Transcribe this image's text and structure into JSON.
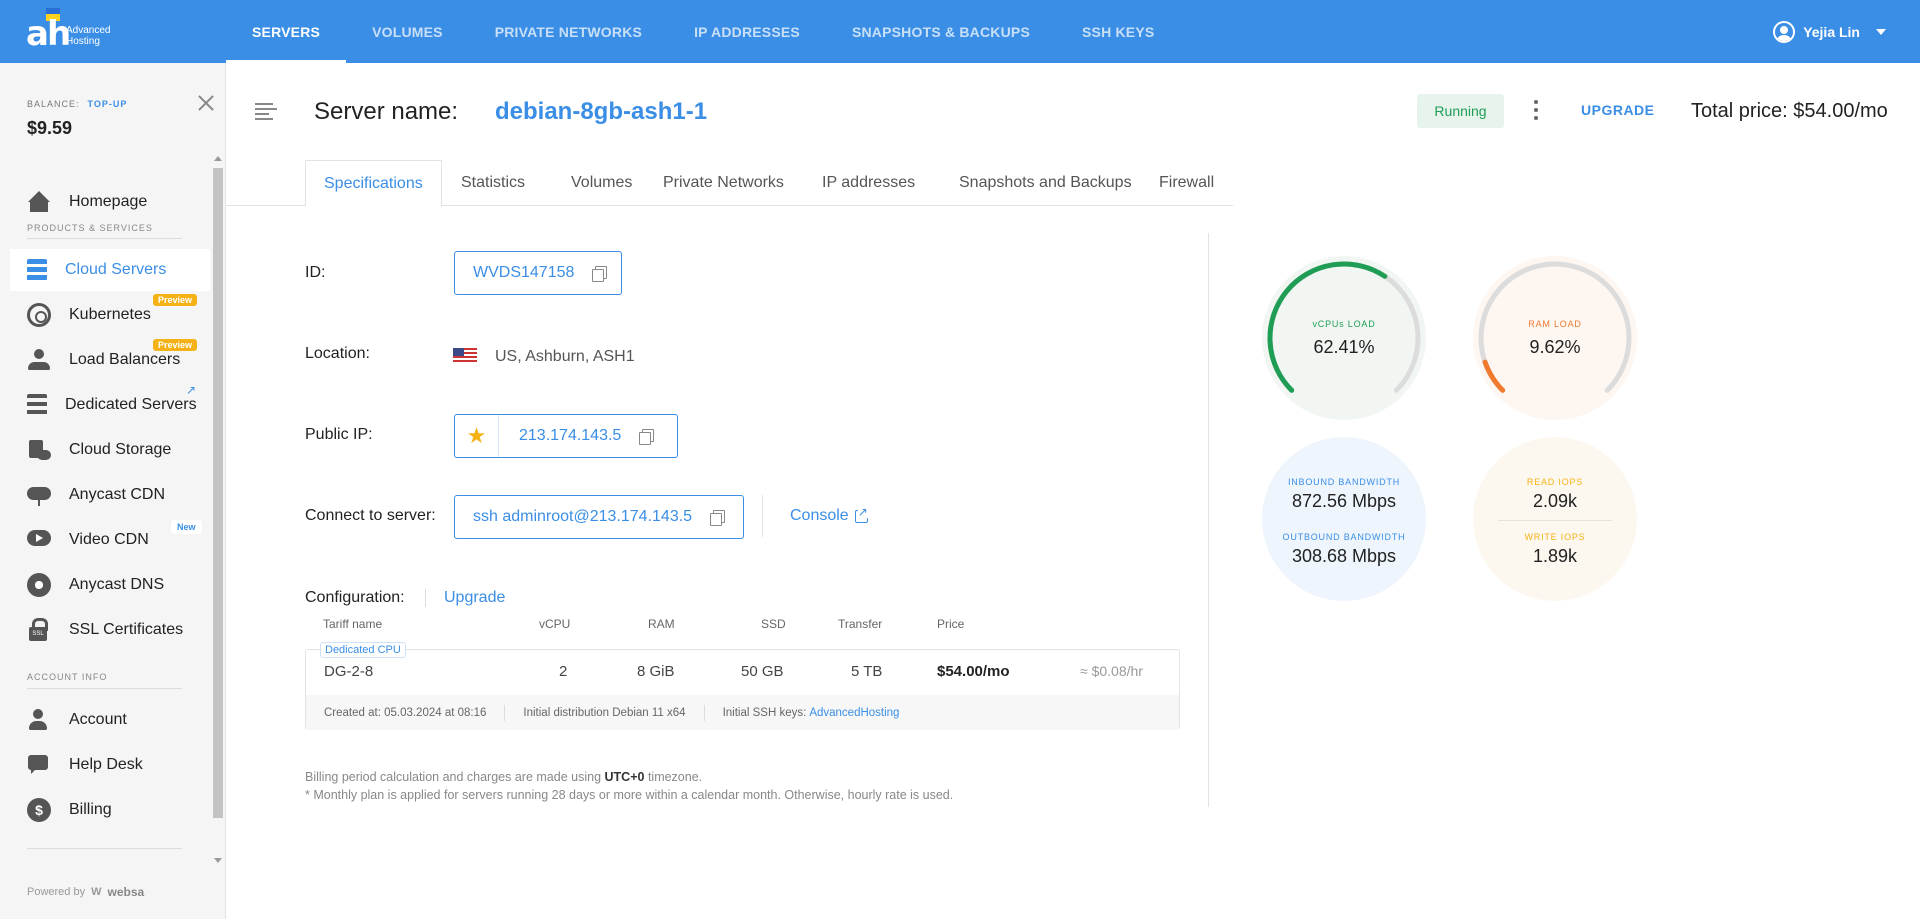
{
  "brand": {
    "logo_text": "ah",
    "logo_sub1": "Advanced",
    "logo_sub2": "Hosting"
  },
  "topnav": {
    "items": [
      "SERVERS",
      "VOLUMES",
      "PRIVATE NETWORKS",
      "IP ADDRESSES",
      "SNAPSHOTS & BACKUPS",
      "SSH KEYS"
    ],
    "active": "SERVERS"
  },
  "user": {
    "name": "Yejia Lin"
  },
  "sidebar": {
    "balance_label": "BALANCE:",
    "topup_label": "TOP-UP",
    "balance_value": "$9.59",
    "section_products": "PRODUCTS & SERVICES",
    "section_account": "ACCOUNT INFO",
    "items": [
      {
        "label": "Homepage",
        "icon": "home-icon"
      },
      {
        "label": "Cloud Servers",
        "icon": "servers-icon",
        "active": true
      },
      {
        "label": "Kubernetes",
        "icon": "kubernetes-icon",
        "badge": "Preview"
      },
      {
        "label": "Load Balancers",
        "icon": "load-balancer-icon",
        "badge": "Preview"
      },
      {
        "label": "Dedicated Servers",
        "icon": "dedicated-servers-icon"
      },
      {
        "label": "Cloud Storage",
        "icon": "cloud-storage-icon"
      },
      {
        "label": "Anycast CDN",
        "icon": "cdn-icon"
      },
      {
        "label": "Video CDN",
        "icon": "video-cdn-icon",
        "badge": "New"
      },
      {
        "label": "Anycast DNS",
        "icon": "dns-icon"
      },
      {
        "label": "SSL Certificates",
        "icon": "ssl-icon"
      },
      {
        "label": "Account",
        "icon": "account-icon"
      },
      {
        "label": "Help Desk",
        "icon": "help-desk-icon"
      },
      {
        "label": "Billing",
        "icon": "billing-icon"
      }
    ],
    "powered_by": "Powered by",
    "powered_brand": "websa"
  },
  "header": {
    "server_label": "Server name:",
    "server_name": "debian-8gb-ash1-1",
    "status": "Running",
    "upgrade_label": "UPGRADE",
    "total_price": "Total price: $54.00/mo"
  },
  "tabs": [
    "Specifications",
    "Statistics",
    "Volumes",
    "Private Networks",
    "IP addresses",
    "Snapshots and Backups",
    "Firewall"
  ],
  "spec": {
    "id_label": "ID:",
    "id_value": "WVDS147158",
    "location_label": "Location:",
    "location_value": "US, Ashburn, ASH1",
    "public_ip_label": "Public IP:",
    "public_ip_value": "213.174.143.5",
    "connect_label": "Connect to server:",
    "connect_value": "ssh adminroot@213.174.143.5",
    "console_label": "Console"
  },
  "config": {
    "label": "Configuration:",
    "upgrade_label": "Upgrade",
    "columns": [
      "Tariff name",
      "vCPU",
      "RAM",
      "SSD",
      "Transfer",
      "Price"
    ],
    "badge": "Dedicated CPU",
    "row": {
      "tariff": "DG-2-8",
      "vcpu": "2",
      "ram": "8 GiB",
      "ssd": "50 GB",
      "transfer": "5 TB",
      "price": "$54.00/mo",
      "hourly": "≈ $0.08/hr"
    },
    "created": "Created at: 05.03.2024 at 08:16",
    "distribution": "Initial distribution Debian 11 x64",
    "ssh_keys_label": "Initial SSH keys:",
    "ssh_keys_value": "AdvancedHosting"
  },
  "notes": {
    "line1_prefix": "Billing period calculation and charges are made using",
    "line1_bold": "UTC+0",
    "line1_suffix": "timezone.",
    "line2": "* Monthly plan is applied for servers running 28 days or more within a calendar month. Otherwise, hourly rate is used."
  },
  "gauges": {
    "vcpu": {
      "label": "vCPUs LOAD",
      "value": "62.41%",
      "fraction": 0.6241,
      "color": "#1f9d55"
    },
    "ram": {
      "label": "RAM LOAD",
      "value": "9.62%",
      "fraction": 0.0962,
      "color": "#f07a2e"
    },
    "bandwidth": {
      "in_label": "INBOUND BANDWIDTH",
      "in_value": "872.56 Mbps",
      "out_label": "OUTBOUND BANDWIDTH",
      "out_value": "308.68 Mbps",
      "color": "#3a8ee6"
    },
    "iops": {
      "read_label": "READ IOPS",
      "read_value": "2.09k",
      "write_label": "WRITE IOPS",
      "write_value": "1.89k",
      "color": "#f5b216"
    }
  }
}
